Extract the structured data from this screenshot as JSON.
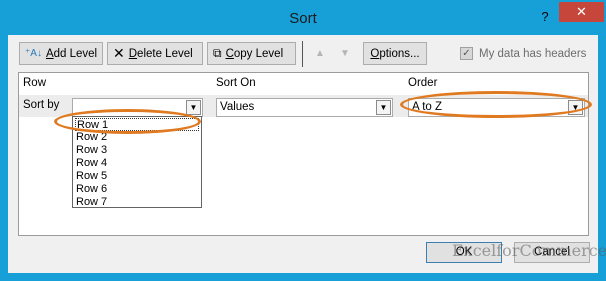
{
  "window": {
    "title": "Sort",
    "help_glyph": "?",
    "close_glyph": "✕"
  },
  "toolbar": {
    "add_level": {
      "prefix": "",
      "underlined": "A",
      "rest": "dd Level"
    },
    "delete_level": {
      "underlined": "D",
      "rest": "elete Level"
    },
    "copy_level": {
      "underlined": "C",
      "rest": "opy Level"
    },
    "move_up_glyph": "▲",
    "move_down_glyph": "▼",
    "options": {
      "underlined": "O",
      "rest": "ptions..."
    },
    "my_data_has_headers": "My data has headers"
  },
  "columns": {
    "row": "Row",
    "sort_on": "Sort On",
    "order": "Order"
  },
  "level": {
    "sort_by_label": "Sort by",
    "row_value": "",
    "sort_on_value": "Values",
    "order_value": "A to Z"
  },
  "row_dropdown": [
    "Row 1",
    "Row 2",
    "Row 3",
    "Row 4",
    "Row 5",
    "Row 6",
    "Row 7"
  ],
  "footer": {
    "ok": "OK",
    "cancel": "Cancel",
    "watermark": "ExcelforCommerce"
  },
  "colors": {
    "accent": "#17a0d8",
    "highlight": "#e07a21",
    "close": "#c7463b"
  }
}
